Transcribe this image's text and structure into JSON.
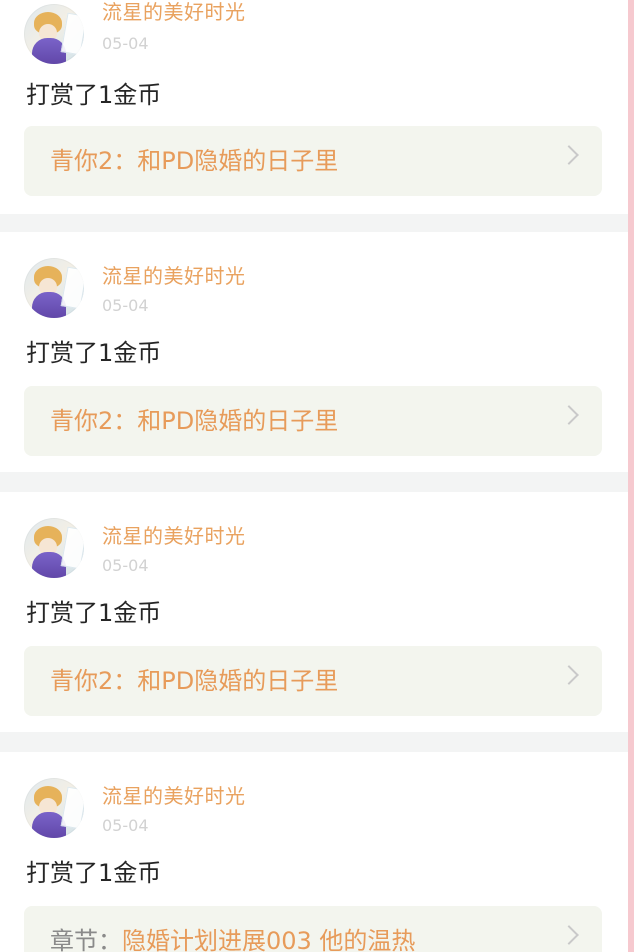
{
  "feed": [
    {
      "username": "流星的美好时光",
      "date": "05-04",
      "message": "打赏了1金币",
      "target": {
        "text": "青你2：和PD隐婚的日子里"
      }
    },
    {
      "username": "流星的美好时光",
      "date": "05-04",
      "message": "打赏了1金币",
      "target": {
        "text": "青你2：和PD隐婚的日子里"
      }
    },
    {
      "username": "流星的美好时光",
      "date": "05-04",
      "message": "打赏了1金币",
      "target": {
        "text": "青你2：和PD隐婚的日子里"
      }
    },
    {
      "username": "流星的美好时光",
      "date": "05-04",
      "message": "打赏了1金币",
      "target": {
        "prefix": "章节：",
        "text": "隐婚计划进展003 他的温热"
      }
    }
  ],
  "colors": {
    "accent": "#e9a25f",
    "link_bg": "#f3f5ee",
    "separator": "#f3f4f4",
    "border_pink": "#f6c9cf"
  },
  "icons": {
    "avatar": "avatar",
    "chevron": "chevron-right-icon"
  }
}
